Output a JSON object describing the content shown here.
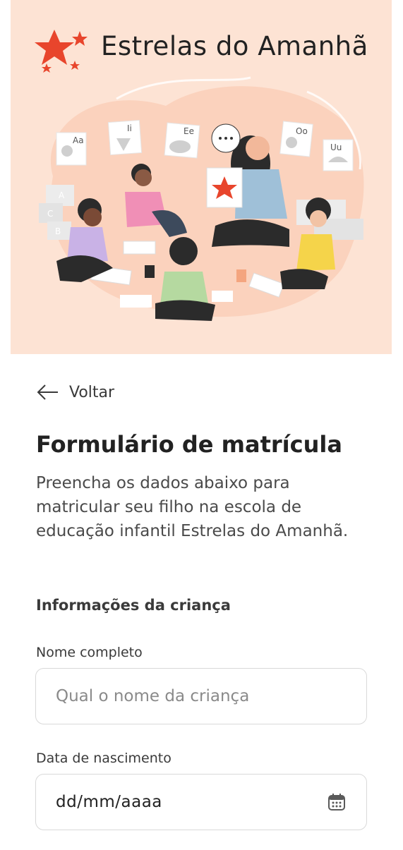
{
  "brand": {
    "name": "Estrelas do Amanhã"
  },
  "illustration": {
    "card_labels": [
      "Aa",
      "Ii",
      "Ee",
      "Oo",
      "Uu",
      "A",
      "B",
      "C"
    ]
  },
  "nav": {
    "back_label": "Voltar"
  },
  "page": {
    "title": "Formulário de matrícula",
    "intro": "Preencha os dados abaixo para matricular seu filho na escola de educação infantil Estrelas do Amanhã."
  },
  "section": {
    "title": "Informações da criança"
  },
  "fields": {
    "name": {
      "label": "Nome completo",
      "placeholder": "Qual o nome da criança",
      "value": ""
    },
    "birth": {
      "label": "Data de nascimento",
      "value": "dd/mm/aaaa"
    }
  },
  "colors": {
    "accent": "#e8452c",
    "hero_bg": "#fde3d4"
  }
}
